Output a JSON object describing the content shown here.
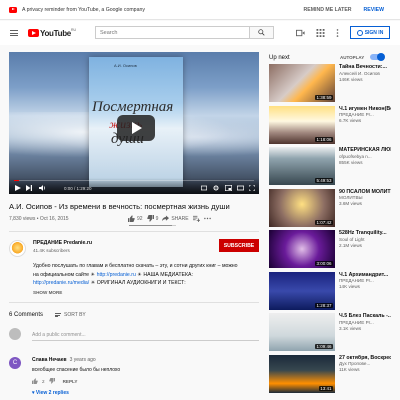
{
  "privacy_bar": {
    "message": "A privacy reminder from YouTube, a Google company",
    "remind_later": "REMIND ME LATER",
    "review": "REVIEW"
  },
  "masthead": {
    "logo_text": "YouTube",
    "region": "RU",
    "search_placeholder": "Search",
    "sign_in": "SIGN IN"
  },
  "player": {
    "book_author": "А.И. Осипов",
    "book_title_1": "Посмертная",
    "book_title_2": "жизнь",
    "book_title_3": "души",
    "time": "0:00 / 1:29:20",
    "progress": 0.02
  },
  "video": {
    "title": "А.И. Осипов - Из времени в вечность: посмертная жизнь души",
    "meta": "7,830 views • Oct 16, 2015",
    "likes": "92",
    "dislikes": "9",
    "share": "SHARE",
    "save_icon": "playlist-add-icon",
    "like_ratio": 0.91
  },
  "owner": {
    "name": "ПРЕДАНИЕ Predanie.ru",
    "subscribers": "41.4K subscribers",
    "subscribe": "SUBSCRIBE"
  },
  "description": {
    "line1": "Удобно послушать по главам и бесплатно скачать – эту, и сотни других книг – можно",
    "line2_pre": "на официальном сайте ☀",
    "line2_link": "http://predanie.ru",
    "line2_post": "☀ НАША МЕДИАТЕКА:",
    "line3_link": "http://predanie.ru/media/",
    "line3_post": "☀ ОРИГИНАЛ АУДИОКНИГИ И ТЕКСТ:",
    "show_more": "SHOW MORE"
  },
  "comments": {
    "count_label": "6 Comments",
    "sort_by": "SORT BY",
    "add_placeholder": "Add a public comment...",
    "items": [
      {
        "author": "Слава Нечаев",
        "when": "3 years ago",
        "avatar_letter": "С",
        "text": "всеобщее спасение было бы неплохо",
        "likes": "2",
        "reply": "REPLY",
        "view_replies": "View 2 replies"
      }
    ]
  },
  "sidebar": {
    "up_next": "Up next",
    "autoplay": "AUTOPLAY",
    "items": [
      {
        "title": "Тайна Вечности:...",
        "channel": "Алексей И. Осипов",
        "views": "146K views",
        "duration": "1:38:59"
      },
      {
        "title": "Ч.1 игумен Никон(Вор...",
        "channel": "ПРЕДАНИЕ Pr...",
        "views": "6.7K views",
        "duration": "1:18:06"
      },
      {
        "title": "МАТЕРИНСКАЯ ЛЮБОВЬ Ака...",
        "channel": "ofpuofsebya n...",
        "views": "855K views",
        "duration": "5:49:53"
      },
      {
        "title": "90 ПСАЛОМ МОЛИТВА от...",
        "channel": "МОЛИТВЫ",
        "views": "3.6M views",
        "duration": "1:07:42"
      },
      {
        "title": "528Hz Tranquility...",
        "channel": "Soul of Light",
        "views": "2.1M views",
        "duration": "3:00:06"
      },
      {
        "title": "Ч.1 Архимандрит...",
        "channel": "ПРЕДАНИЕ Pr...",
        "views": "14K views",
        "duration": "1:28:37"
      },
      {
        "title": "Ч.5 Блез Паскаль -...",
        "channel": "ПРЕДАНИЕ Pr...",
        "views": "3.1K views",
        "duration": "1:09:46"
      },
      {
        "title": "27 октября, Воскресен...",
        "channel": "Дух Пропове...",
        "views": "11K views",
        "duration": "13:41"
      }
    ]
  }
}
